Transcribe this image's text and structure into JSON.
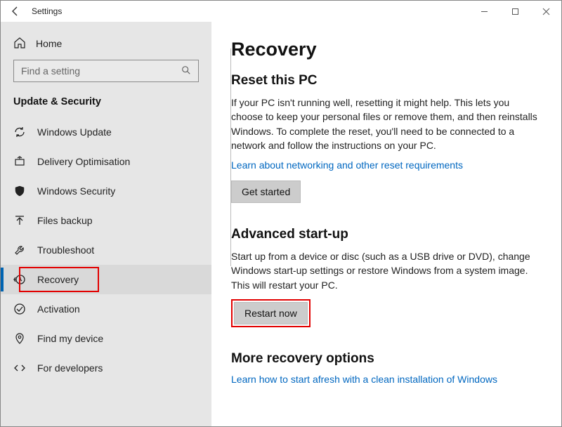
{
  "window": {
    "title": "Settings",
    "back_aria": "Back"
  },
  "sidebar": {
    "home_label": "Home",
    "search_placeholder": "Find a setting",
    "section_header": "Update & Security",
    "items": [
      {
        "label": "Windows Update",
        "icon": "sync-icon"
      },
      {
        "label": "Delivery Optimisation",
        "icon": "delivery-icon"
      },
      {
        "label": "Windows Security",
        "icon": "shield-icon"
      },
      {
        "label": "Files backup",
        "icon": "backup-icon"
      },
      {
        "label": "Troubleshoot",
        "icon": "troubleshoot-icon"
      },
      {
        "label": "Recovery",
        "icon": "recovery-icon",
        "selected": true
      },
      {
        "label": "Activation",
        "icon": "activation-icon"
      },
      {
        "label": "Find my device",
        "icon": "find-device-icon"
      },
      {
        "label": "For developers",
        "icon": "developers-icon"
      }
    ]
  },
  "main": {
    "title": "Recovery",
    "reset": {
      "heading": "Reset this PC",
      "body": "If your PC isn't running well, resetting it might help. This lets you choose to keep your personal files or remove them, and then reinstalls Windows. To complete the reset, you'll need to be connected to a network and follow the instructions on your PC.",
      "link": "Learn about networking and other reset requirements",
      "button": "Get started"
    },
    "advanced": {
      "heading": "Advanced start-up",
      "body": "Start up from a device or disc (such as a USB drive or DVD), change Windows start-up settings or restore Windows from a system image. This will restart your PC.",
      "button": "Restart now"
    },
    "more": {
      "heading": "More recovery options",
      "link": "Learn how to start afresh with a clean installation of Windows"
    }
  }
}
